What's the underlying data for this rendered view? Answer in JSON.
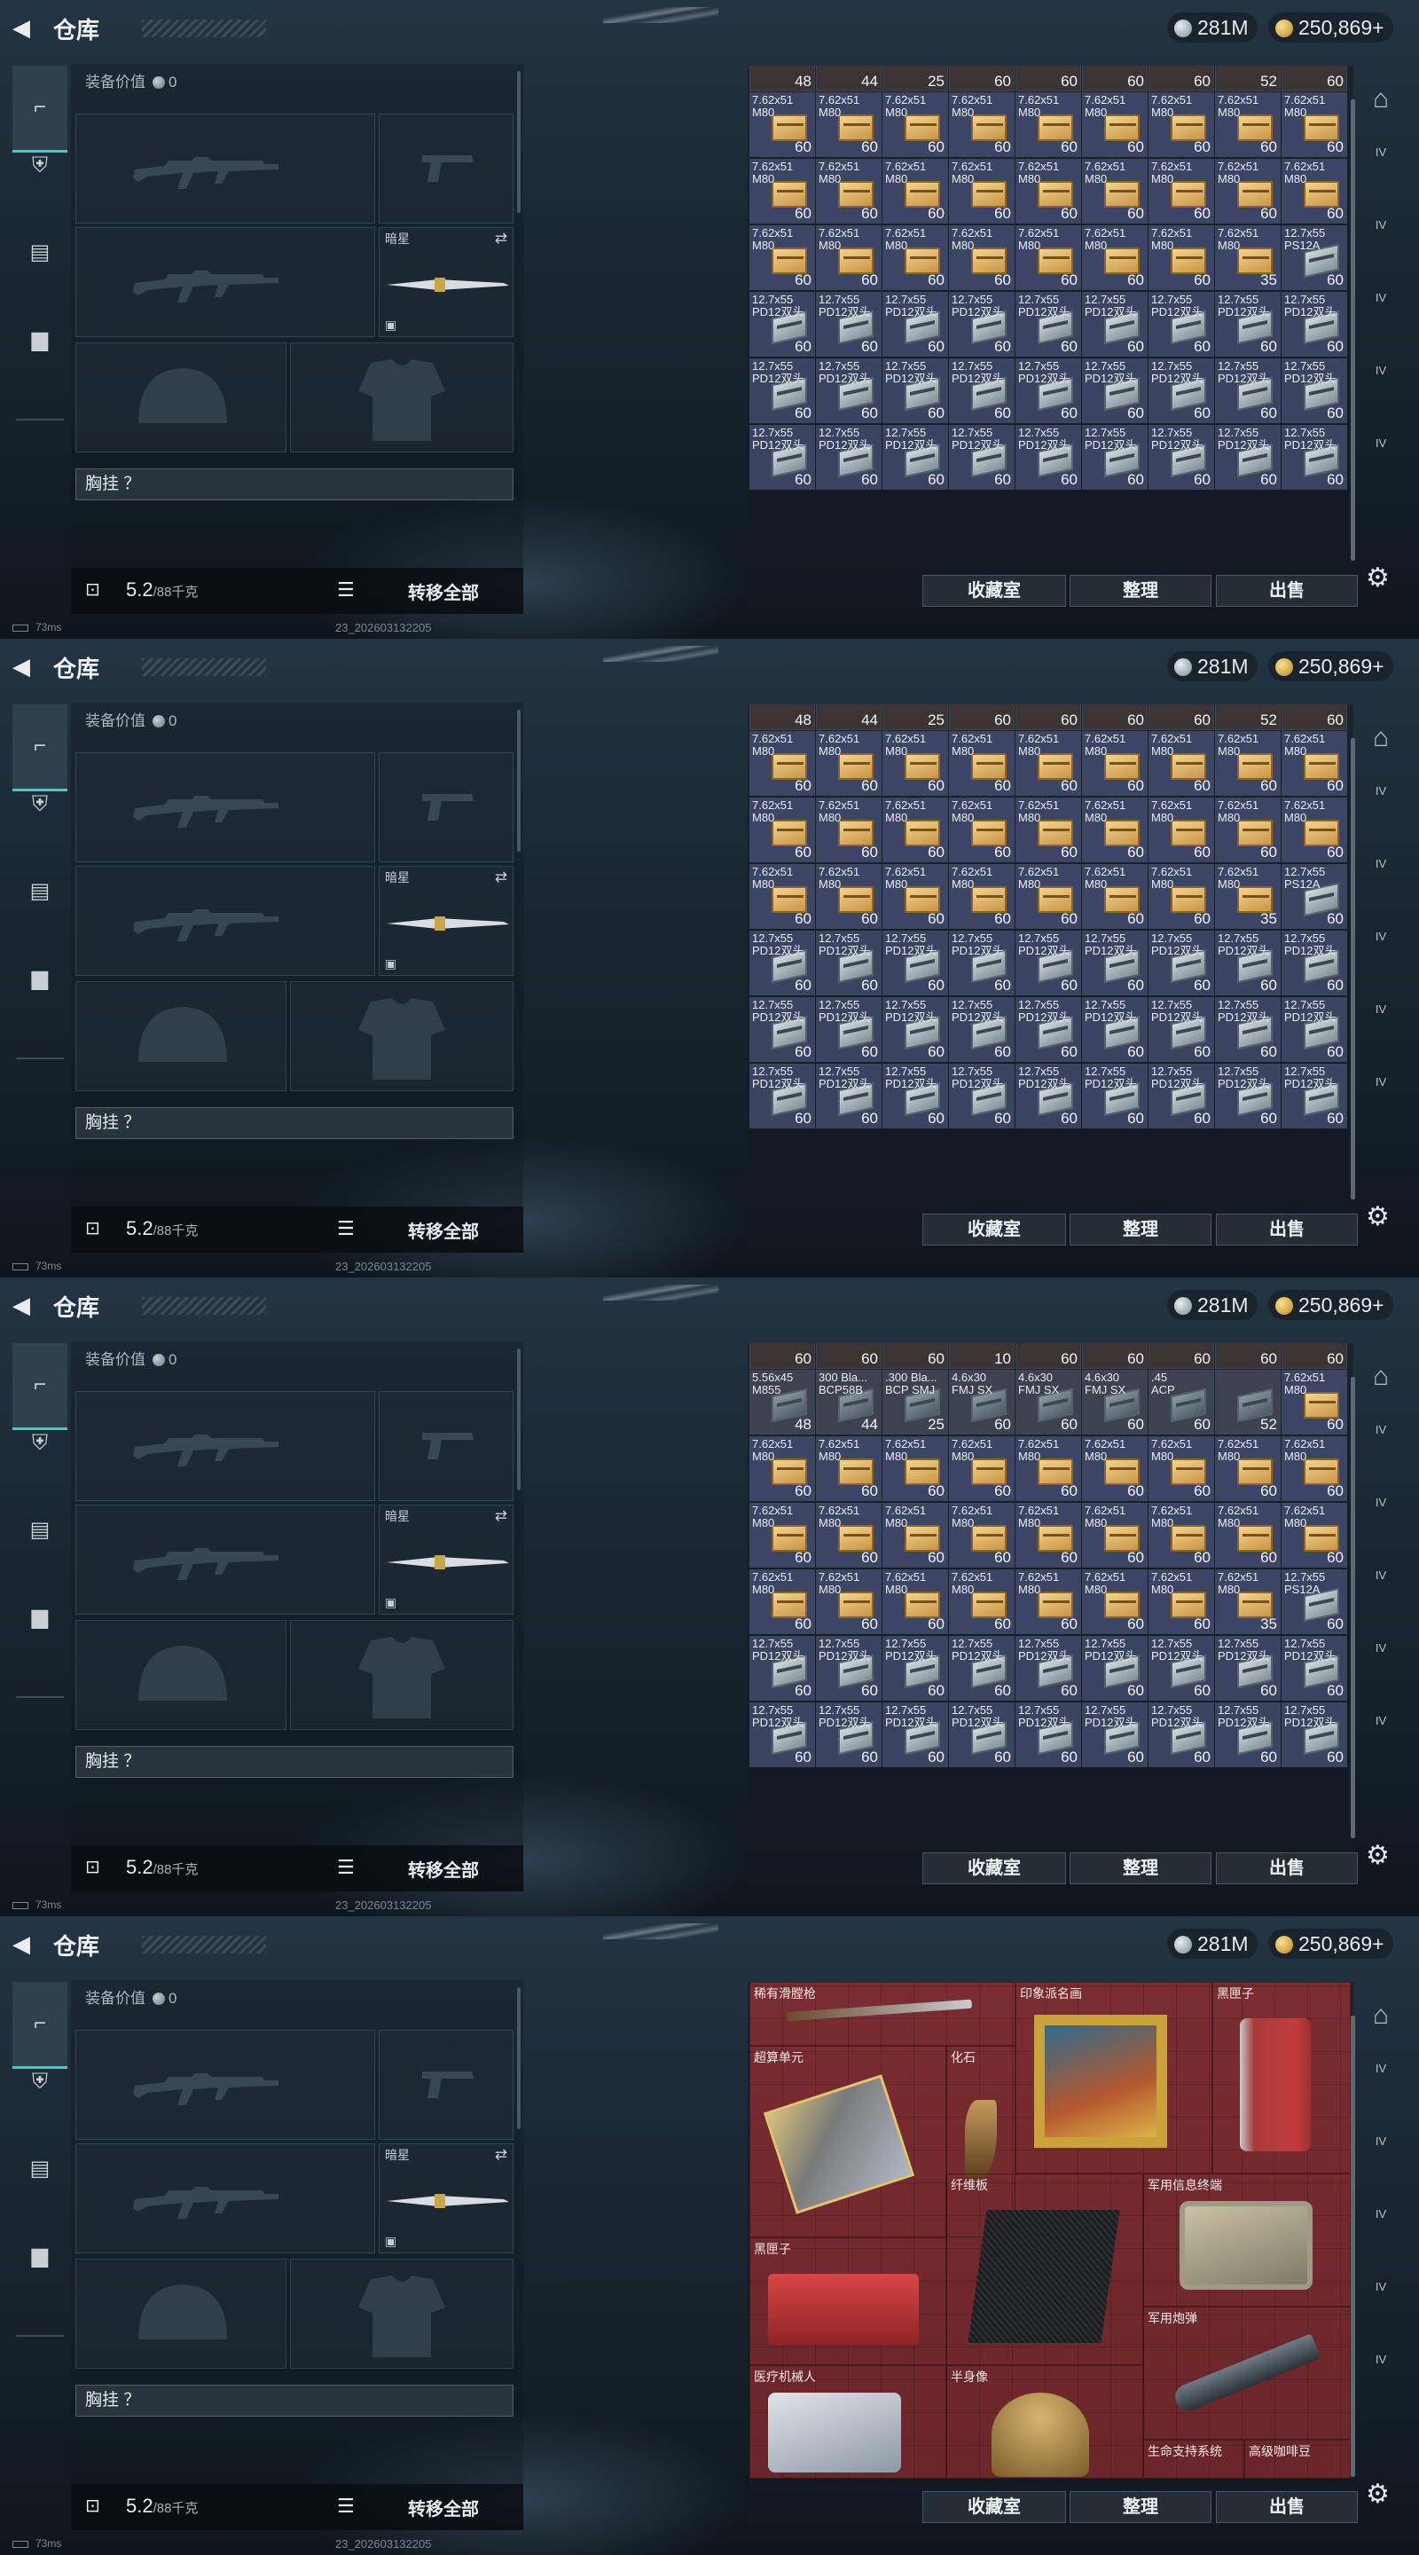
{
  "app": {
    "title": "仓库",
    "currency_silver": "281M",
    "currency_gold": "250,869+"
  },
  "loadout": {
    "equip_value_label": "装备价值",
    "equip_value": "0",
    "melee_label": "暗星",
    "chest_label": "胸挂 ？",
    "weight": "5.2",
    "weight_cap": "/88千克",
    "transfer_all": "转移全部"
  },
  "status": {
    "ping": "73ms",
    "build": "23_202603132205"
  },
  "stash": {
    "buttons": [
      "收藏室",
      "整理",
      "出售"
    ],
    "right_nav": [
      "IV",
      "IV",
      "IV",
      "IV",
      "IV"
    ]
  },
  "frames": [
    {
      "partial_counts": [
        "48",
        "44",
        "25",
        "60",
        "60",
        "60",
        "60",
        "52",
        "60"
      ],
      "rows": [
        {
          "type": "762",
          "names": [
            "7.62x51\nM80",
            "7.62x51\nM80",
            "7.62x51\nM80",
            "7.62x51\nM80",
            "7.62x51\nM80",
            "7.62x51\nM80",
            "7.62x51\nM80",
            "7.62x51\nM80",
            "7.62x51\nM80"
          ],
          "counts": [
            "60",
            "60",
            "60",
            "60",
            "60",
            "60",
            "60",
            "60",
            "60"
          ]
        },
        {
          "type": "762",
          "names": [
            "7.62x51\nM80",
            "7.62x51\nM80",
            "7.62x51\nM80",
            "7.62x51\nM80",
            "7.62x51\nM80",
            "7.62x51\nM80",
            "7.62x51\nM80",
            "7.62x51\nM80",
            "7.62x51\nM80"
          ],
          "counts": [
            "60",
            "60",
            "60",
            "60",
            "60",
            "60",
            "60",
            "60",
            "60"
          ]
        },
        {
          "type": "mix",
          "names": [
            "7.62x51\nM80",
            "7.62x51\nM80",
            "7.62x51\nM80",
            "7.62x51\nM80",
            "7.62x51\nM80",
            "7.62x51\nM80",
            "7.62x51\nM80",
            "7.62x51\nM80",
            "12.7x55\nPS12A"
          ],
          "counts": [
            "60",
            "60",
            "60",
            "60",
            "60",
            "60",
            "60",
            "35",
            "60"
          ]
        },
        {
          "type": "127",
          "names": [
            "12.7x55\nPD12双头",
            "12.7x55\nPD12双头",
            "12.7x55\nPD12双头",
            "12.7x55\nPD12双头",
            "12.7x55\nPD12双头",
            "12.7x55\nPD12双头",
            "12.7x55\nPD12双头",
            "12.7x55\nPD12双头",
            "12.7x55\nPD12双头"
          ],
          "counts": [
            "60",
            "60",
            "60",
            "60",
            "60",
            "60",
            "60",
            "60",
            "60"
          ]
        },
        {
          "type": "127",
          "names": [
            "12.7x55\nPD12双头",
            "12.7x55\nPD12双头",
            "12.7x55\nPD12双头",
            "12.7x55\nPD12双头",
            "12.7x55\nPD12双头",
            "12.7x55\nPD12双头",
            "12.7x55\nPD12双头",
            "12.7x55\nPD12双头",
            "12.7x55\nPD12双头"
          ],
          "counts": [
            "60",
            "60",
            "60",
            "60",
            "60",
            "60",
            "60",
            "60",
            "60"
          ]
        },
        {
          "type": "127",
          "names": [
            "12.7x55\nPD12双头",
            "12.7x55\nPD12双头",
            "12.7x55\nPD12双头",
            "12.7x55\nPD12双头",
            "12.7x55\nPD12双头",
            "12.7x55\nPD12双头",
            "12.7x55\nPD12双头",
            "12.7x55\nPD12双头",
            "12.7x55\nPD12双头"
          ],
          "counts": [
            "60",
            "60",
            "60",
            "60",
            "60",
            "60",
            "60",
            "60",
            "60"
          ]
        }
      ]
    },
    {
      "partial_counts": [
        "48",
        "44",
        "25",
        "60",
        "60",
        "60",
        "60",
        "52",
        "60"
      ],
      "rows": [
        {
          "type": "762",
          "names": [
            "7.62x51\nM80",
            "7.62x51\nM80",
            "7.62x51\nM80",
            "7.62x51\nM80",
            "7.62x51\nM80",
            "7.62x51\nM80",
            "7.62x51\nM80",
            "7.62x51\nM80",
            "7.62x51\nM80"
          ],
          "counts": [
            "60",
            "60",
            "60",
            "60",
            "60",
            "60",
            "60",
            "60",
            "60"
          ]
        },
        {
          "type": "762",
          "names": [
            "7.62x51\nM80",
            "7.62x51\nM80",
            "7.62x51\nM80",
            "7.62x51\nM80",
            "7.62x51\nM80",
            "7.62x51\nM80",
            "7.62x51\nM80",
            "7.62x51\nM80",
            "7.62x51\nM80"
          ],
          "counts": [
            "60",
            "60",
            "60",
            "60",
            "60",
            "60",
            "60",
            "60",
            "60"
          ]
        },
        {
          "type": "mix",
          "names": [
            "7.62x51\nM80",
            "7.62x51\nM80",
            "7.62x51\nM80",
            "7.62x51\nM80",
            "7.62x51\nM80",
            "7.62x51\nM80",
            "7.62x51\nM80",
            "7.62x51\nM80",
            "12.7x55\nPS12A"
          ],
          "counts": [
            "60",
            "60",
            "60",
            "60",
            "60",
            "60",
            "60",
            "35",
            "60"
          ]
        },
        {
          "type": "127",
          "names": [
            "12.7x55\nPD12双头",
            "12.7x55\nPD12双头",
            "12.7x55\nPD12双头",
            "12.7x55\nPD12双头",
            "12.7x55\nPD12双头",
            "12.7x55\nPD12双头",
            "12.7x55\nPD12双头",
            "12.7x55\nPD12双头",
            "12.7x55\nPD12双头"
          ],
          "counts": [
            "60",
            "60",
            "60",
            "60",
            "60",
            "60",
            "60",
            "60",
            "60"
          ]
        },
        {
          "type": "127",
          "names": [
            "12.7x55\nPD12双头",
            "12.7x55\nPD12双头",
            "12.7x55\nPD12双头",
            "12.7x55\nPD12双头",
            "12.7x55\nPD12双头",
            "12.7x55\nPD12双头",
            "12.7x55\nPD12双头",
            "12.7x55\nPD12双头",
            "12.7x55\nPD12双头"
          ],
          "counts": [
            "60",
            "60",
            "60",
            "60",
            "60",
            "60",
            "60",
            "60",
            "60"
          ]
        },
        {
          "type": "127",
          "names": [
            "12.7x55\nPD12双头",
            "12.7x55\nPD12双头",
            "12.7x55\nPD12双头",
            "12.7x55\nPD12双头",
            "12.7x55\nPD12双头",
            "12.7x55\nPD12双头",
            "12.7x55\nPD12双头",
            "12.7x55\nPD12双头",
            "12.7x55\nPD12双头"
          ],
          "counts": [
            "60",
            "60",
            "60",
            "60",
            "60",
            "60",
            "60",
            "60",
            "60"
          ]
        }
      ]
    },
    {
      "partial_counts": [
        "60",
        "60",
        "60",
        "10",
        "60",
        "60",
        "60",
        "60",
        "60"
      ],
      "rows": [
        {
          "type": "mixtop",
          "names": [
            "5.56x45\nM855",
            "300 Bla...\nBCP58B",
            ".300 Bla...\nBCP SMJ",
            "4.6x30\nFMJ SX",
            "4.6x30\nFMJ SX",
            "4.6x30\nFMJ SX",
            ".45\nACP",
            " ",
            "7.62x51\nM80"
          ],
          "counts": [
            "48",
            "44",
            "25",
            "60",
            "60",
            "60",
            "60",
            "52",
            "60"
          ]
        },
        {
          "type": "762",
          "names": [
            "7.62x51\nM80",
            "7.62x51\nM80",
            "7.62x51\nM80",
            "7.62x51\nM80",
            "7.62x51\nM80",
            "7.62x51\nM80",
            "7.62x51\nM80",
            "7.62x51\nM80",
            "7.62x51\nM80"
          ],
          "counts": [
            "60",
            "60",
            "60",
            "60",
            "60",
            "60",
            "60",
            "60",
            "60"
          ]
        },
        {
          "type": "762",
          "names": [
            "7.62x51\nM80",
            "7.62x51\nM80",
            "7.62x51\nM80",
            "7.62x51\nM80",
            "7.62x51\nM80",
            "7.62x51\nM80",
            "7.62x51\nM80",
            "7.62x51\nM80",
            "7.62x51\nM80"
          ],
          "counts": [
            "60",
            "60",
            "60",
            "60",
            "60",
            "60",
            "60",
            "60",
            "60"
          ]
        },
        {
          "type": "mix",
          "names": [
            "7.62x51\nM80",
            "7.62x51\nM80",
            "7.62x51\nM80",
            "7.62x51\nM80",
            "7.62x51\nM80",
            "7.62x51\nM80",
            "7.62x51\nM80",
            "7.62x51\nM80",
            "12.7x55\nPS12A"
          ],
          "counts": [
            "60",
            "60",
            "60",
            "60",
            "60",
            "60",
            "60",
            "35",
            "60"
          ]
        },
        {
          "type": "127",
          "names": [
            "12.7x55\nPD12双头",
            "12.7x55\nPD12双头",
            "12.7x55\nPD12双头",
            "12.7x55\nPD12双头",
            "12.7x55\nPD12双头",
            "12.7x55\nPD12双头",
            "12.7x55\nPD12双头",
            "12.7x55\nPD12双头",
            "12.7x55\nPD12双头"
          ],
          "counts": [
            "60",
            "60",
            "60",
            "60",
            "60",
            "60",
            "60",
            "60",
            "60"
          ]
        },
        {
          "type": "127",
          "names": [
            "12.7x55\nPD12双头",
            "12.7x55\nPD12双头",
            "12.7x55\nPD12双头",
            "12.7x55\nPD12双头",
            "12.7x55\nPD12双头",
            "12.7x55\nPD12双头",
            "12.7x55\nPD12双头",
            "12.7x55\nPD12双头",
            "12.7x55\nPD12双头"
          ],
          "counts": [
            "60",
            "60",
            "60",
            "60",
            "60",
            "60",
            "60",
            "60",
            "60"
          ]
        }
      ]
    }
  ],
  "collection": {
    "items": [
      "稀有滑膛枪",
      "印象派名画",
      "黑匣子",
      "超算单元",
      "化石",
      "纤维板",
      "军用信息终端",
      "黑匣子",
      "军用炮弹",
      "医疗机械人",
      "半身像",
      "生命支持系统",
      "高级咖啡豆"
    ]
  }
}
